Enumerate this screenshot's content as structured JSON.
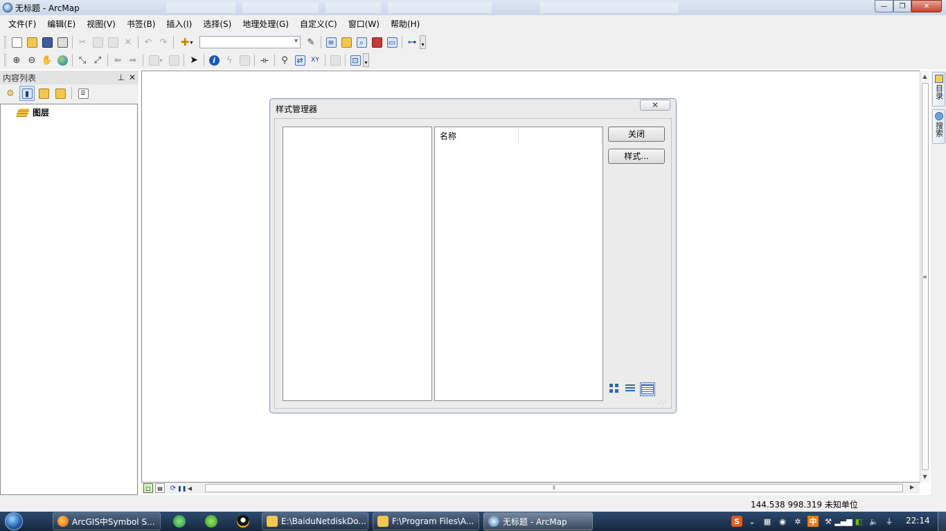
{
  "window": {
    "title": "无标题 - ArcMap",
    "controls": {
      "minimize": "—",
      "maximize": "❐",
      "close": "✕"
    }
  },
  "menu": [
    "文件(F)",
    "编辑(E)",
    "视图(V)",
    "书签(B)",
    "插入(I)",
    "选择(S)",
    "地理处理(G)",
    "自定义(C)",
    "窗口(W)",
    "帮助(H)"
  ],
  "toolbar": {
    "scale_value": ""
  },
  "toc": {
    "title": "内容列表",
    "pin_glyph": "⊥",
    "close_glyph": "✕",
    "layer_root": "图层"
  },
  "right_dock": {
    "catalog_tab": "目录",
    "search_tab": "搜索"
  },
  "status": {
    "coordinates": "144.538  998.319 未知单位"
  },
  "dialog": {
    "title": "样式管理器",
    "close_glyph": "✕",
    "name_column": "名称",
    "close_button": "关闭",
    "styles_button": "样式..."
  },
  "taskbar": {
    "tasks": [
      {
        "label": "ArcGIS中Symbol S...",
        "icon": "firefox-icon"
      },
      {
        "label": "E:\\BaiduNetdiskDo...",
        "icon": "folder-icon"
      },
      {
        "label": "F:\\Program Files\\A...",
        "icon": "folder-icon"
      },
      {
        "label": "无标题 - ArcMap",
        "icon": "arcmap-icon"
      }
    ],
    "tray_sogou": "S",
    "tray_ime": "中",
    "clock": "22:14"
  }
}
